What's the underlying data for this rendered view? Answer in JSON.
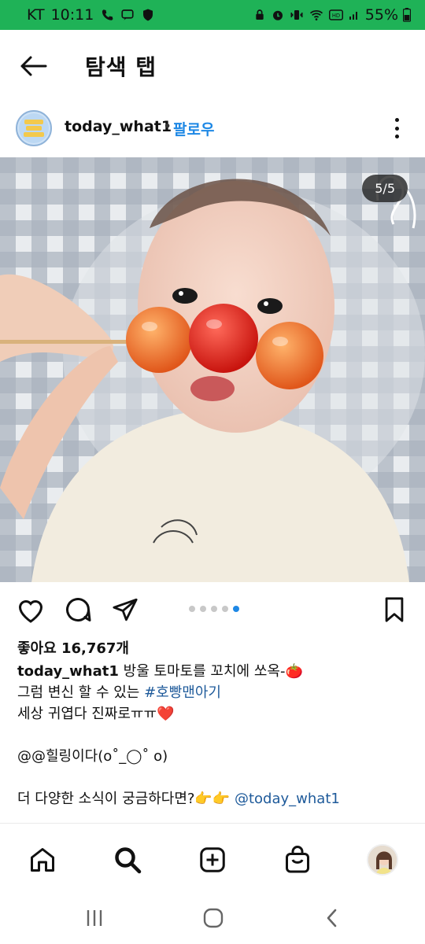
{
  "status_bar": {
    "carrier": "KT",
    "time": "10:11",
    "battery": "55%",
    "icons": [
      "phone-icon",
      "chat-icon",
      "shield-icon",
      "lock-icon",
      "alarm-icon",
      "vibrate-icon",
      "wifi-icon",
      "hd-icon",
      "signal-icon",
      "battery-icon"
    ]
  },
  "header": {
    "title": "탐색 탭",
    "back_icon": "arrow-left-icon"
  },
  "post": {
    "username": "today_what1",
    "separator": "•",
    "follow_label": "팔로우",
    "more_icon": "more-vertical-icon",
    "image_counter": "5/5",
    "carousel": {
      "total": 5,
      "active_index": 4
    },
    "likes": "좋아요 16,767개",
    "caption": {
      "user": "today_what1",
      "line1": " 방울 토마토를 꼬치에 쏘옥-🍅",
      "line2_prefix": "그럼 변신 할 수 있는 ",
      "line2_hashtag": "#호빵맨아기",
      "line3": "세상 귀엽다 진짜로ㅠㅠ❤️",
      "line4": "@@힐링이다(o˚_◯˚ o)",
      "line5_prefix": "더 다양한 소식이 궁금하다면?👉👉 ",
      "line5_mention": "@today_what1"
    }
  },
  "actions": [
    "heart-icon",
    "comment-icon",
    "share-icon",
    "bookmark-icon"
  ],
  "bottom_nav": [
    "home-icon",
    "search-icon",
    "add-post-icon",
    "shop-icon",
    "profile-avatar"
  ],
  "system_nav": [
    "recent-apps-icon",
    "home-circle-icon",
    "back-chevron-icon"
  ],
  "colors": {
    "status_bar": "#1fb257",
    "accent": "#1e88e5",
    "hashtag": "#1e5a9a"
  }
}
